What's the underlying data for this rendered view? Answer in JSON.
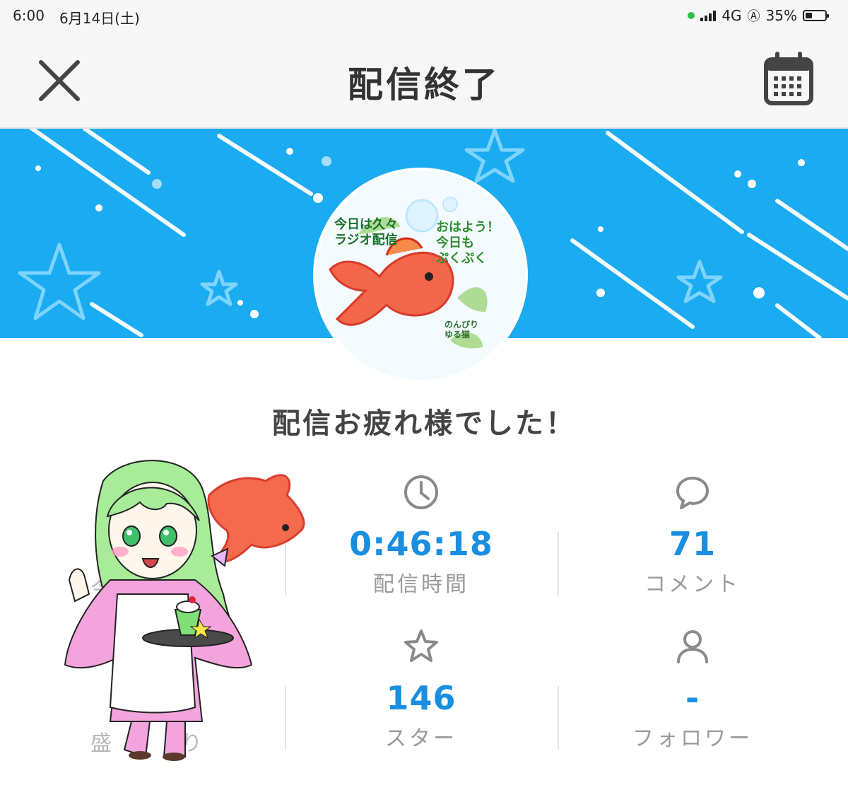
{
  "status_bar": {
    "time": "6:00",
    "date": "6月14日(土)",
    "network": "4G",
    "battery": "35%",
    "battery_level": 0.35
  },
  "header": {
    "title": "配信終了",
    "close_icon": "close-icon",
    "calendar_icon": "calendar-icon"
  },
  "thumbnail": {
    "text_left": "今日は久々\nラジオ配信",
    "text_right": "おはよう！\n今日も\nぷくぷく",
    "text_bottom": "のんびり\nゆる猫"
  },
  "message": "配信お疲れ様でした！",
  "stats": [
    {
      "icon": "clock-icon",
      "value": "0:46:18",
      "label": "配信時間"
    },
    {
      "icon": "comment-icon",
      "value": "71",
      "label": "コメント"
    },
    {
      "icon": "star-icon",
      "value": "146",
      "label": "スター"
    },
    {
      "icon": "user-icon",
      "value": "-",
      "label": "フォロワー"
    }
  ],
  "partial_labels": {
    "top_left": "今",
    "bottom_left": "盛",
    "bottom_left_tail": "り"
  },
  "colors": {
    "banner": "#1aabf0",
    "accent": "#1a8ee0",
    "label_gray": "#9a9a9a"
  }
}
